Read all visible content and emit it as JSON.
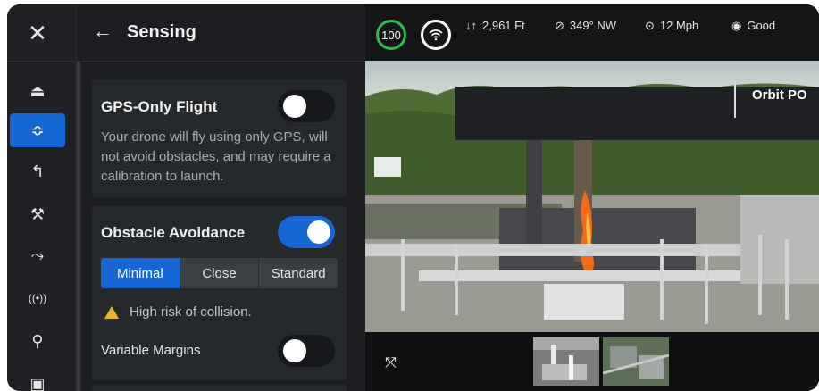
{
  "rail": {
    "close_icon": "close-icon",
    "items": [
      {
        "icon": "takeoff-icon",
        "glyph": "⏏",
        "active": false
      },
      {
        "icon": "sensing-icon",
        "glyph": "≎",
        "active": true
      },
      {
        "icon": "return-home-icon",
        "glyph": "↰",
        "active": false
      },
      {
        "icon": "tools-icon",
        "glyph": "⚒",
        "active": false
      },
      {
        "icon": "flight-path-icon",
        "glyph": "⤳",
        "active": false
      },
      {
        "icon": "radio-icon",
        "glyph": "((•))",
        "active": false
      },
      {
        "icon": "antenna-icon",
        "glyph": "⚲",
        "active": false
      },
      {
        "icon": "gallery-icon",
        "glyph": "▣",
        "active": false
      }
    ]
  },
  "panel": {
    "title": "Sensing",
    "gps_only": {
      "title": "GPS-Only Flight",
      "enabled": false,
      "description": "Your drone will fly using only GPS, will not avoid obstacles, and may require a calibration to launch."
    },
    "obstacle_avoidance": {
      "title": "Obstacle Avoidance",
      "enabled": true,
      "modes": [
        "Minimal",
        "Close",
        "Standard"
      ],
      "selected_mode": "Minimal",
      "warning": "High risk of collision.",
      "variable_margins_label": "Variable Margins",
      "variable_margins_enabled": false
    }
  },
  "telemetry": {
    "battery": "100",
    "altitude": "2,961 Ft",
    "heading": "349° NW",
    "speed": "12 Mph",
    "link_quality": "Good"
  },
  "camera": {
    "mode_label": "Orbit PO"
  },
  "colors": {
    "accent": "#1766d6",
    "battery_ring": "#2fbf48",
    "warning": "#f0b428"
  }
}
